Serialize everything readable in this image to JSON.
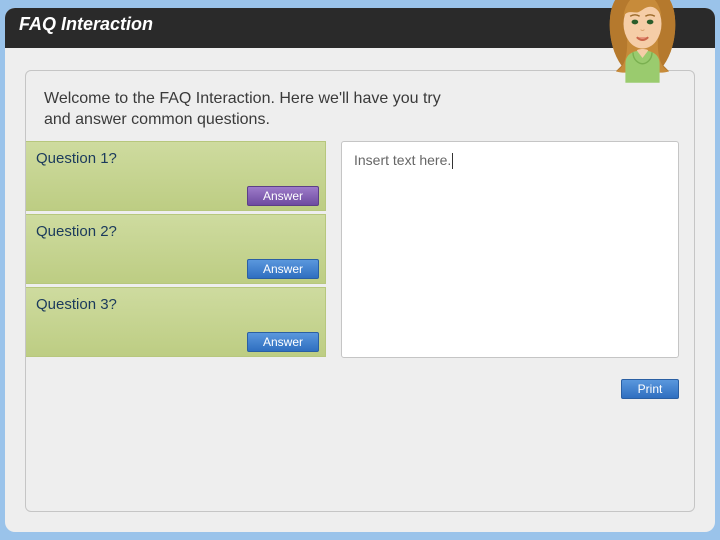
{
  "titlebar": {
    "title": "FAQ Interaction"
  },
  "intro": "Welcome to the FAQ Interaction. Here we'll have you try and answer common questions.",
  "questions": [
    {
      "label": "Question 1?",
      "button": "Answer",
      "variant": "purple"
    },
    {
      "label": "Question 2?",
      "button": "Answer",
      "variant": "blue"
    },
    {
      "label": "Question 3?",
      "button": "Answer",
      "variant": "blue"
    }
  ],
  "answerArea": {
    "placeholder": "Insert text here."
  },
  "footer": {
    "print": "Print"
  },
  "avatar": {
    "name": "female-avatar"
  }
}
